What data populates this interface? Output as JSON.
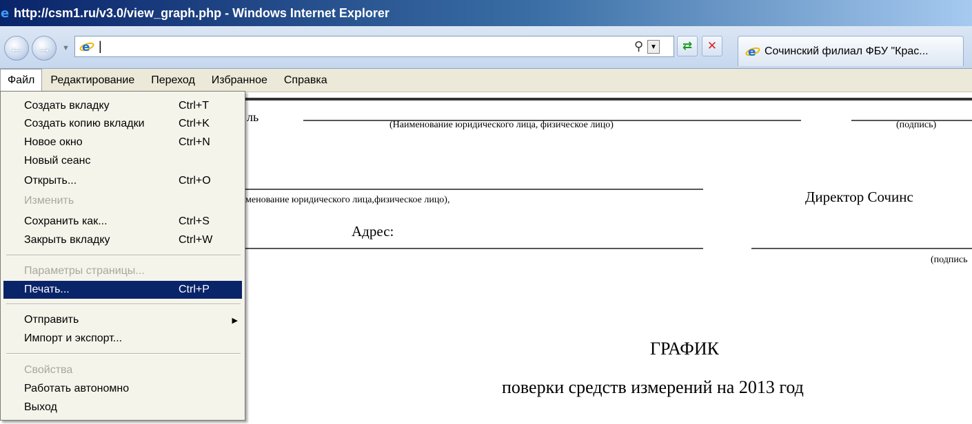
{
  "window": {
    "title": "http://csm1.ru/v3.0/view_graph.php - Windows Internet Explorer"
  },
  "address": {
    "value": "|"
  },
  "tab": {
    "label": "Сочинский филиал ФБУ \"Крас..."
  },
  "menubar": [
    "Файл",
    "Редактирование",
    "Переход",
    "Избранное",
    "Справка"
  ],
  "file_menu": [
    {
      "label": "Создать вкладку",
      "shortcut": "Ctrl+T"
    },
    {
      "label": "Создать копию вкладки",
      "shortcut": "Ctrl+K"
    },
    {
      "label": "Новое окно",
      "shortcut": "Ctrl+N"
    },
    {
      "label": "Новый сеанс",
      "shortcut": ""
    },
    {
      "label": "Открыть...",
      "shortcut": "Ctrl+O"
    },
    {
      "label": "Изменить",
      "shortcut": ""
    },
    {
      "label": "Сохранить как...",
      "shortcut": "Ctrl+S"
    },
    {
      "label": "Закрыть вкладку",
      "shortcut": "Ctrl+W"
    },
    {
      "label": "Параметры страницы...",
      "shortcut": ""
    },
    {
      "label": "Печать...",
      "shortcut": "Ctrl+P"
    },
    {
      "label": "Отправить",
      "shortcut": ""
    },
    {
      "label": "Импорт и экспорт...",
      "shortcut": ""
    },
    {
      "label": "Свойства",
      "shortcut": ""
    },
    {
      "label": "Работать автономно",
      "shortcut": ""
    },
    {
      "label": "Выход",
      "shortcut": ""
    }
  ],
  "document": {
    "fragment_top": "ль",
    "caption_org1": "(Наименование юридического лица, физическое лицо)",
    "caption_sig1": "(подпись)",
    "caption_org2": "менование юридического лица,физическое лицо),",
    "director": "Директор Сочинс",
    "address_label": "Адрес:",
    "caption_sig2": "(подпись",
    "heading": "ГРАФИК",
    "subheading": "поверки средств измерений на 2013 год"
  }
}
